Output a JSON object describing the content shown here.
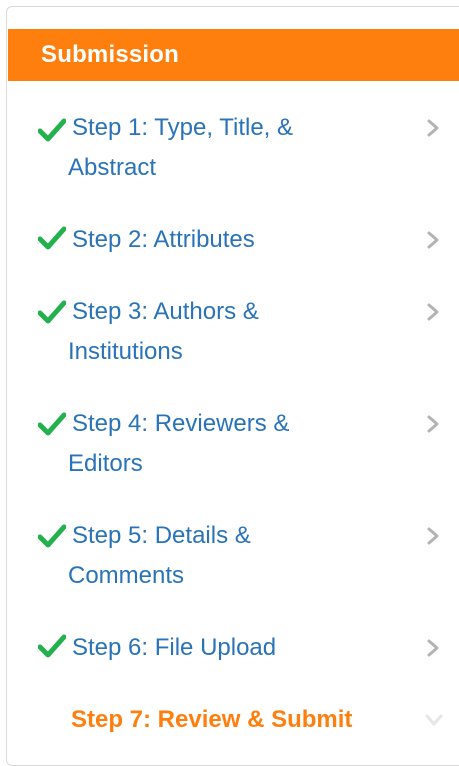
{
  "panel": {
    "title": "Submission"
  },
  "steps": [
    {
      "line1": "Step 1: Type, Title, &",
      "line2": "Abstract",
      "complete": true
    },
    {
      "line1": "Step 2: Attributes",
      "line2": "",
      "complete": true
    },
    {
      "line1": "Step 3: Authors &",
      "line2": "Institutions",
      "complete": true
    },
    {
      "line1": "Step 4: Reviewers &",
      "line2": "Editors",
      "complete": true
    },
    {
      "line1": "Step 5: Details &",
      "line2": "Comments",
      "complete": true
    },
    {
      "line1": "Step 6: File Upload",
      "line2": "",
      "complete": true
    },
    {
      "line1": "Step 7: Review & Submit",
      "line2": "",
      "complete": false,
      "current": true
    }
  ],
  "icons": {
    "complete": "checkmark-icon",
    "navigate": "chevron-right-icon",
    "current": "chevron-down-icon"
  },
  "colors": {
    "accent": "#ff7f0e",
    "link": "#2a73b8",
    "check": "#22b14c",
    "chevron": "#b3b3b3",
    "border": "#d9d9d9"
  }
}
